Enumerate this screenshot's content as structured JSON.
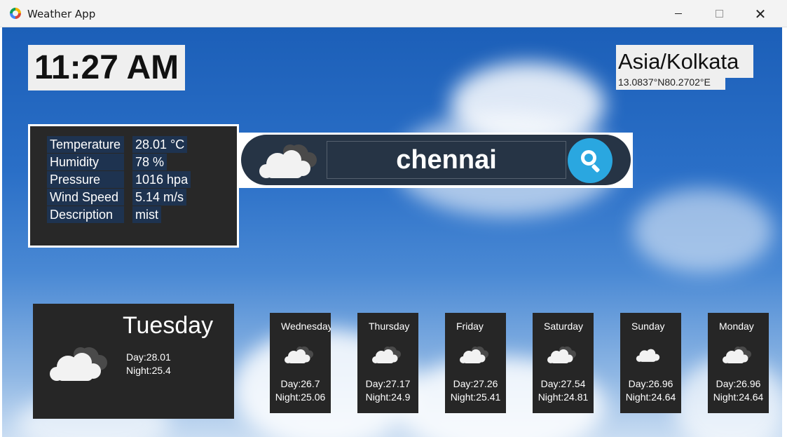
{
  "window": {
    "title": "Weather App",
    "close_glyph": "✕"
  },
  "clock": {
    "time": "11:27 AM"
  },
  "location": {
    "timezone": "Asia/Kolkata",
    "coordinates": "13.0837°N80.2702°E"
  },
  "current": {
    "rows": [
      {
        "label": "Temperature",
        "value": "28.01 °C"
      },
      {
        "label": "Humidity",
        "value": "78 %"
      },
      {
        "label": "Pressure",
        "value": "1016 hpa"
      },
      {
        "label": "Wind Speed",
        "value": "5.14 m/s"
      },
      {
        "label": "Description",
        "value": "mist"
      }
    ]
  },
  "search": {
    "value": "chennai",
    "icon": "search-icon"
  },
  "today": {
    "day": "Tuesday",
    "day_temp": "Day:28.01",
    "night_temp": "Night:25.4",
    "icon": "cloud-icon"
  },
  "forecast": [
    {
      "day": "Wednesday",
      "day_temp": "Day:26.7",
      "night_temp": "Night:25.06"
    },
    {
      "day": "Thursday",
      "day_temp": "Day:27.17",
      "night_temp": "Night:24.9"
    },
    {
      "day": "Friday",
      "day_temp": "Day:27.26",
      "night_temp": "Night:25.41"
    },
    {
      "day": "Saturday",
      "day_temp": "Day:27.54",
      "night_temp": "Night:24.81"
    },
    {
      "day": "Sunday",
      "day_temp": "Day:26.96",
      "night_temp": "Night:24.64"
    },
    {
      "day": "Monday",
      "day_temp": "Day:26.96",
      "night_temp": "Night:24.64"
    }
  ],
  "colors": {
    "panel": "#262626",
    "label_bg": "#1e3350",
    "search_pill": "#263445",
    "search_button": "#2aa7e0"
  }
}
